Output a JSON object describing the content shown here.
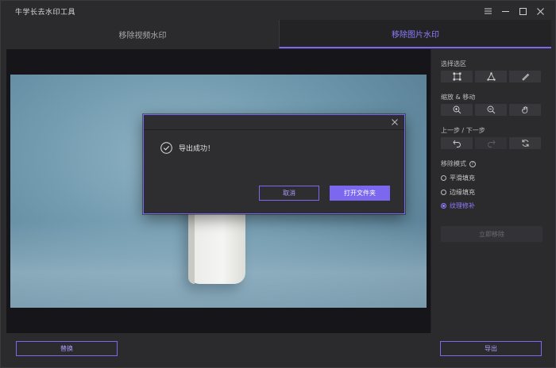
{
  "app": {
    "title": "牛学长去水印工具"
  },
  "window_controls": {
    "menu": "menu-icon",
    "minimize": "minimize-icon",
    "maximize": "maximize-icon",
    "close": "close-icon"
  },
  "tabs": [
    {
      "label": "移除视频水印",
      "active": false
    },
    {
      "label": "移除图片水印",
      "active": true
    }
  ],
  "side_panel": {
    "select_area_label": "选择选区",
    "select_tools": [
      "rectangle-select-icon",
      "polygon-select-icon",
      "brush-icon"
    ],
    "zoom_label": "缩放 & 移动",
    "zoom_tools": [
      "zoom-in-icon",
      "zoom-out-icon",
      "hand-icon"
    ],
    "history_label": "上一步 / 下一步",
    "history_tools": [
      "undo-icon",
      "redo-icon",
      "reset-icon"
    ],
    "mode_label": "移除模式",
    "modes": [
      {
        "label": "平滑填充",
        "checked": false
      },
      {
        "label": "边缘填充",
        "checked": false
      },
      {
        "label": "纹理修补",
        "checked": true
      }
    ],
    "remove_now_label": "立即移除"
  },
  "bottom": {
    "replace_label": "替换",
    "export_label": "导出"
  },
  "dialog": {
    "message": "导出成功！",
    "cancel_label": "取消",
    "open_folder_label": "打开文件夹"
  },
  "colors": {
    "accent": "#7b68ee",
    "background": "#2b2b2e",
    "canvas": "#16161a"
  }
}
